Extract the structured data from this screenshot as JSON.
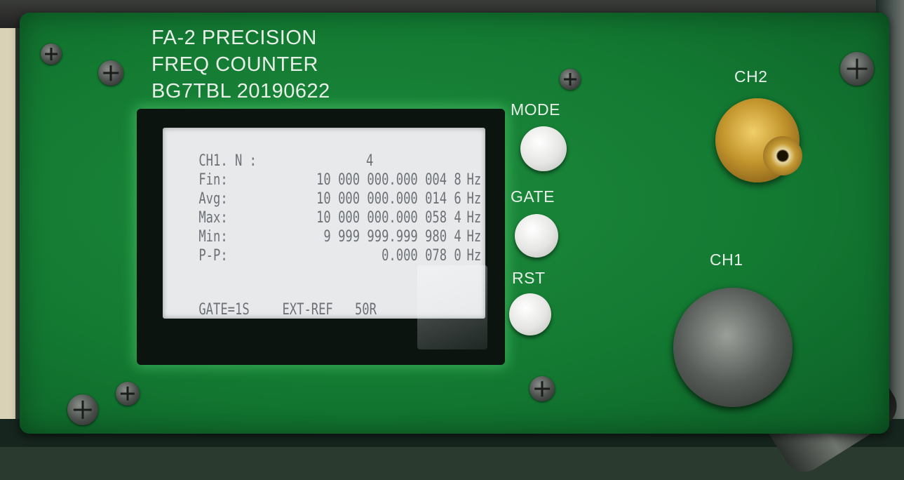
{
  "device": {
    "title_line1": "FA-2 PRECISION",
    "title_line2": "FREQ COUNTER",
    "title_line3": "BG7TBL 20190622",
    "buttons": {
      "mode": "MODE",
      "gate": "GATE",
      "rst": "RST"
    },
    "ports": {
      "ch2": "CH2",
      "ch1": "CH1"
    }
  },
  "lcd": {
    "header_left": "CH1. N :",
    "header_value": "4",
    "rows": [
      {
        "label": "Fin:",
        "value": "10 000 000.000 004 8",
        "unit": "Hz"
      },
      {
        "label": "Avg:",
        "value": "10 000 000.000 014 6",
        "unit": "Hz"
      },
      {
        "label": "Max:",
        "value": "10 000 000.000 058 4",
        "unit": "Hz"
      },
      {
        "label": "Min:",
        "value": "9 999 999.999 980 4",
        "unit": "Hz"
      },
      {
        "label": "P-P:",
        "value": "0.000 078 0",
        "unit": "Hz"
      }
    ],
    "status_gate": "GATE=1S",
    "status_ref": "EXT-REF",
    "status_impedance": "50R"
  },
  "colors": {
    "panel": "#137a32",
    "lcd_background": "#e7e9eb",
    "lcd_text": "#6d7176",
    "silkscreen": "#e8efe8"
  }
}
